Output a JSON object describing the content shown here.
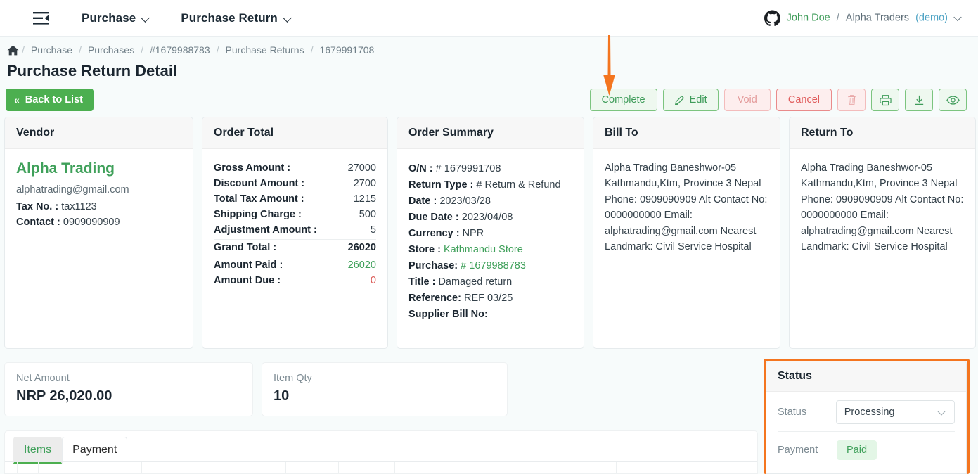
{
  "topnav": {
    "menu_icon": "menu-collapse-icon",
    "items": [
      {
        "label": "Purchase",
        "icon": "chevron-down-icon"
      },
      {
        "label": "Purchase Return",
        "icon": "chevron-down-icon"
      }
    ],
    "user": {
      "avatar_icon": "github-icon",
      "name": "John Doe",
      "separator": "/",
      "org": "Alpha Traders",
      "mode": "(demo)",
      "caret_icon": "chevron-down-icon"
    }
  },
  "breadcrumb": {
    "home_icon": "home-icon",
    "separator": "/",
    "items": [
      "Purchase",
      "Purchases",
      "#1679988783",
      "Purchase Returns",
      "1679991708"
    ]
  },
  "page_title": "Purchase Return Detail",
  "toolbar": {
    "back_label": "Back to List",
    "back_icon": "double-chevron-left-icon",
    "actions": [
      {
        "label": "Complete",
        "name": "complete-button",
        "style": "green",
        "disabled": false
      },
      {
        "label": "Edit",
        "name": "edit-button",
        "style": "green",
        "icon": "pencil-icon",
        "disabled": false
      },
      {
        "label": "Void",
        "name": "void-button",
        "style": "redish",
        "disabled": true
      },
      {
        "label": "Cancel",
        "name": "cancel-button",
        "style": "red",
        "disabled": false
      }
    ],
    "icon_actions": [
      {
        "name": "delete-button",
        "icon": "trash-icon",
        "disabled": true
      },
      {
        "name": "print-button",
        "icon": "printer-icon",
        "disabled": false
      },
      {
        "name": "download-button",
        "icon": "download-icon",
        "disabled": false
      },
      {
        "name": "preview-button",
        "icon": "eye-icon",
        "disabled": false
      }
    ]
  },
  "vendor": {
    "title": "Vendor",
    "name": "Alpha Trading",
    "email": "alphatrading@gmail.com",
    "tax_label": "Tax No. :",
    "tax_value": "tax1123",
    "contact_label": "Contact :",
    "contact_value": "0909090909"
  },
  "order_total": {
    "title": "Order Total",
    "rows": [
      {
        "label": "Gross Amount :",
        "value": "27000",
        "style": ""
      },
      {
        "label": "Discount Amount :",
        "value": "2700",
        "style": ""
      },
      {
        "label": "Total Tax Amount :",
        "value": "1215",
        "style": ""
      },
      {
        "label": "Shipping Charge :",
        "value": "500",
        "style": ""
      },
      {
        "label": "Adjustment Amount :",
        "value": "5",
        "style": ""
      },
      {
        "label": "Grand Total :",
        "value": "26020",
        "style": "bold"
      },
      {
        "label": "Amount Paid :",
        "value": "26020",
        "style": "green"
      },
      {
        "label": "Amount Due :",
        "value": "0",
        "style": "red"
      }
    ]
  },
  "order_summary": {
    "title": "Order Summary",
    "rows": [
      {
        "label": "O/N :",
        "value": "# 1679991708",
        "link": false
      },
      {
        "label": "Return Type :",
        "value": "# Return & Refund",
        "link": false
      },
      {
        "label": "Date :",
        "value": "2023/03/28",
        "link": false
      },
      {
        "label": "Due Date :",
        "value": "2023/04/08",
        "link": false
      },
      {
        "label": "Currency :",
        "value": "NPR",
        "link": false
      },
      {
        "label": "Store :",
        "value": "Kathmandu Store",
        "link": true
      },
      {
        "label": "Purchase:",
        "value": "# 1679988783",
        "link": true
      },
      {
        "label": "Title :",
        "value": "Damaged return",
        "link": false
      },
      {
        "label": "Reference:",
        "value": "REF 03/25",
        "link": false
      },
      {
        "label": "Supplier Bill No:",
        "value": "",
        "link": false
      }
    ]
  },
  "bill_to": {
    "title": "Bill To",
    "address": "Alpha Trading Baneshwor-05 Kathmandu,Ktm, Province 3 Nepal Phone: 0909090909 Alt Contact No: 0000000000 Email: alphatrading@gmail.com Nearest Landmark: Civil Service Hospital"
  },
  "return_to": {
    "title": "Return To",
    "address": "Alpha Trading Baneshwor-05 Kathmandu,Ktm, Province 3 Nepal Phone: 0909090909 Alt Contact No: 0000000000 Email: alphatrading@gmail.com Nearest Landmark: Civil Service Hospital"
  },
  "stats": [
    {
      "label": "Net Amount",
      "value": "NRP 26,020.00",
      "name": "net-amount-card"
    },
    {
      "label": "Item Qty",
      "value": "10",
      "name": "item-qty-card"
    }
  ],
  "tabs": [
    {
      "label": "Items",
      "active": true
    },
    {
      "label": "Payment",
      "active": false
    }
  ],
  "status_panel": {
    "title": "Status",
    "status_label": "Status",
    "status_value": "Processing",
    "status_caret_icon": "chevron-down-icon",
    "payment_label": "Payment",
    "payment_value": "Paid"
  },
  "annotation": {
    "arrow_icon": "down-arrow-annotation",
    "target": "Complete",
    "highlight_target": "Status"
  },
  "colors": {
    "brand_green": "#4caf50",
    "link_green": "#3fa05a",
    "danger_red": "#e05c5c",
    "annotation_orange": "#f4751f",
    "page_bg": "#f7fbfb",
    "muted": "#7d8b93"
  }
}
